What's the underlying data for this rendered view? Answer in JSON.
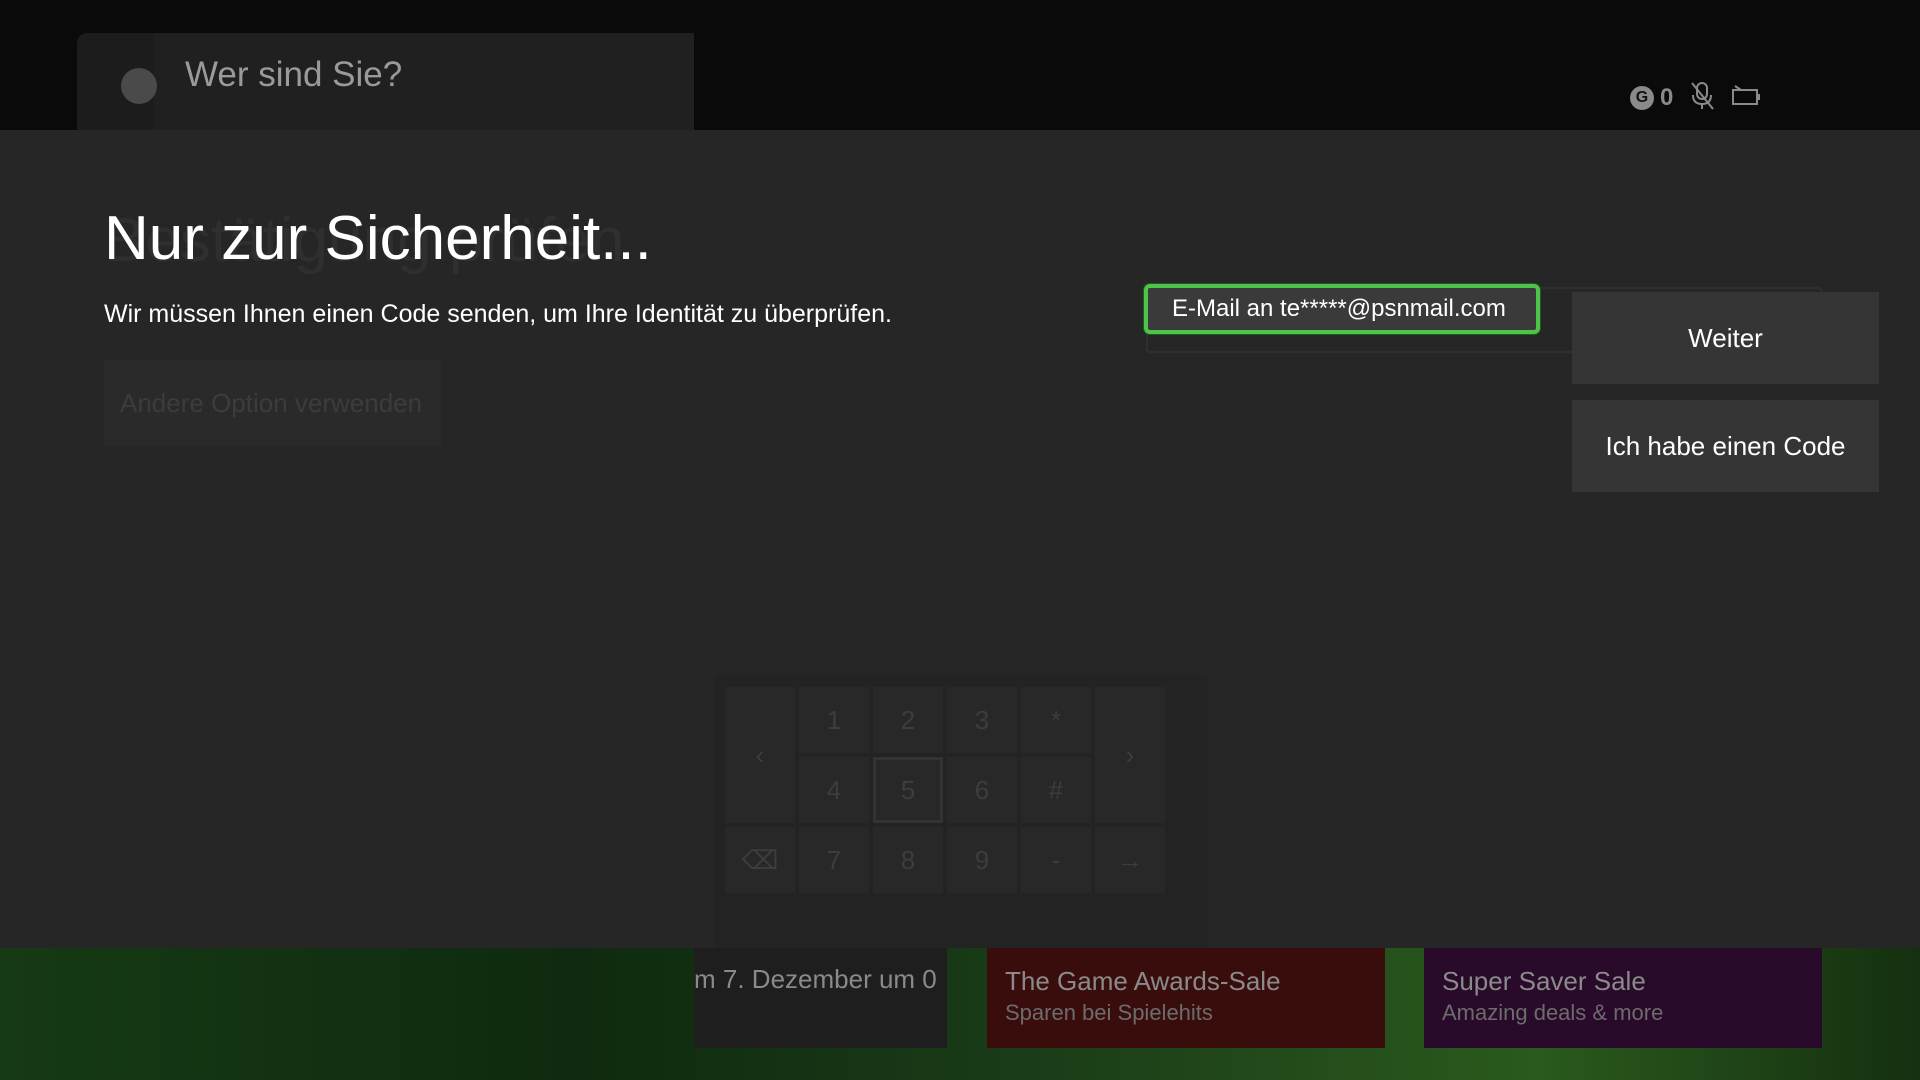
{
  "background": {
    "header_title": "Wer sind Sie?",
    "gamerscore": "0",
    "tiles": [
      {
        "title": "m 7. Dezember um 0",
        "subtitle": ""
      },
      {
        "title": "The Game Awards-Sale",
        "subtitle": "Sparen bei Spielehits"
      },
      {
        "title": "Super Saver Sale",
        "subtitle": "Amazing deals & more"
      }
    ],
    "status_icons": [
      "gamerscore-icon",
      "mic-muted-icon",
      "battery-icon"
    ]
  },
  "dialog": {
    "title": "Nur zur Sicherheit...",
    "subtitle": "Wir müssen Ihnen einen Code senden, um Ihre Identität zu überprüfen.",
    "ghost_title": "Bestätigung prüfen",
    "ghost_option": "Andere Option verwenden",
    "email_option": "E-Mail an te*****@psnmail.com",
    "buttons": {
      "next": "Weiter",
      "have_code": "Ich habe einen Code"
    }
  },
  "keypad": {
    "keys": [
      "1",
      "2",
      "3",
      "*",
      "4",
      "5",
      "6",
      "#",
      "7",
      "8",
      "9",
      "-"
    ]
  },
  "colors": {
    "focus_green": "#4ec44a",
    "overlay_bg": "#262626",
    "button_bg": "#353535"
  }
}
